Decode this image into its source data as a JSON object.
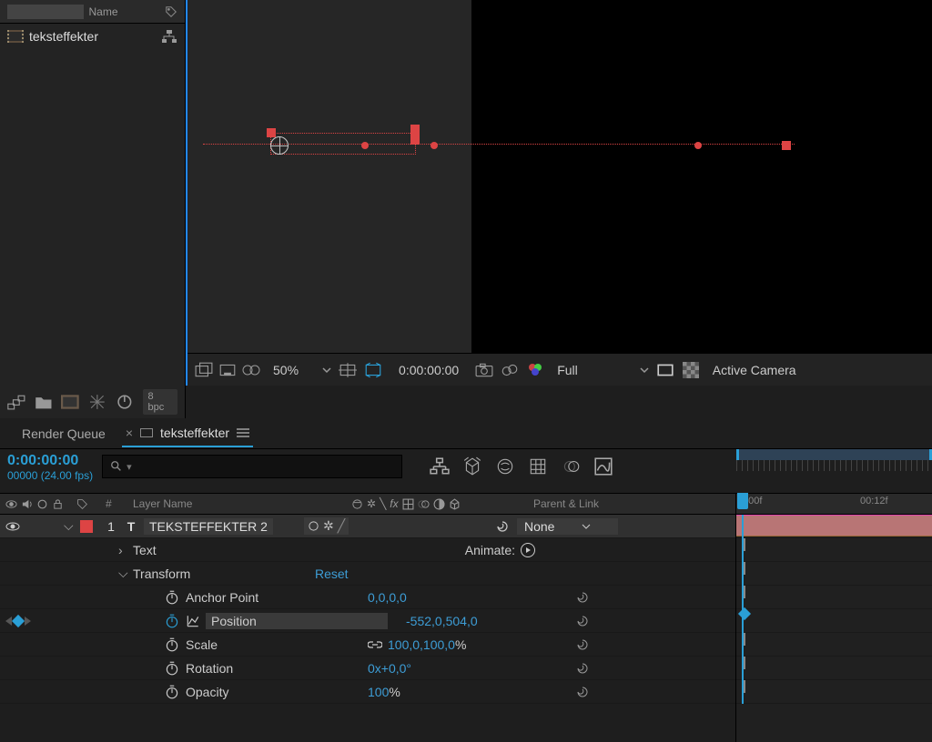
{
  "project": {
    "name_header": "Name",
    "item": "teksteffekter"
  },
  "viewer": {
    "zoom": "50%",
    "timecode": "0:00:00:00",
    "resolution": "Full",
    "camera": "Active Camera",
    "bpc": "8 bpc"
  },
  "tabs": {
    "render_queue": "Render Queue",
    "comp": "teksteffekter"
  },
  "timeline": {
    "current_time": "0:00:00:00",
    "frame_info": "00000 (24.00 fps)",
    "ruler_0": "1:00f",
    "ruler_12": "00:12f"
  },
  "columns": {
    "num": "#",
    "layer_name": "Layer Name",
    "parent": "Parent & Link"
  },
  "layer": {
    "number": "1",
    "type": "T",
    "name": "TEKSTEFFEKTER 2",
    "parent_value": "None"
  },
  "props": {
    "text": "Text",
    "animate": "Animate:",
    "transform": "Transform",
    "reset": "Reset",
    "anchor_point": "Anchor Point",
    "anchor_point_val": "0,0,0,0",
    "position": "Position",
    "position_val": "-552,0,504,0",
    "scale": "Scale",
    "scale_val": "100,0,100,0",
    "scale_pct": "%",
    "rotation": "Rotation",
    "rotation_val": "0x+0,0°",
    "opacity": "Opacity",
    "opacity_val": "100",
    "opacity_pct": "%"
  }
}
